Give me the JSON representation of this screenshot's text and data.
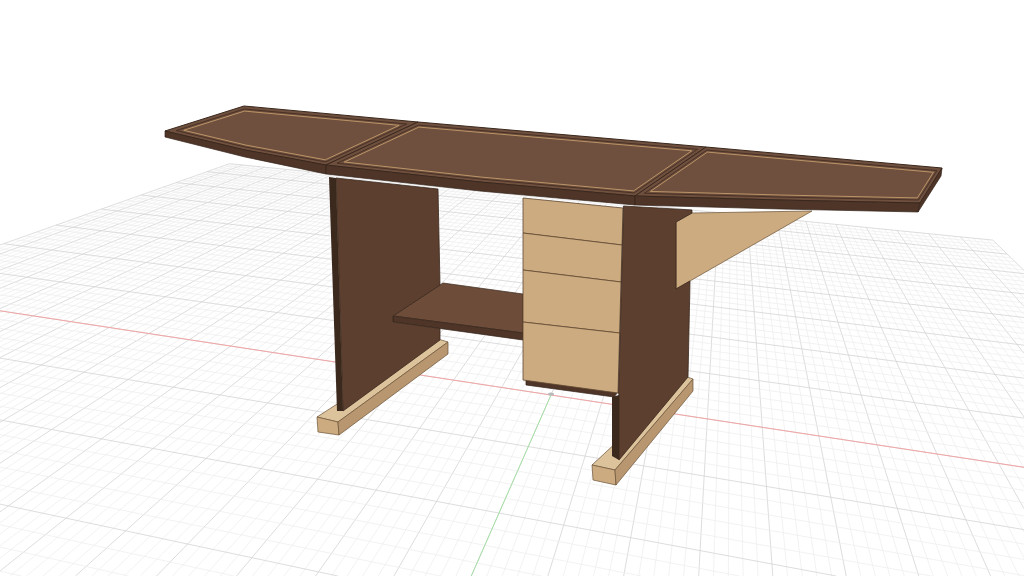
{
  "viewport": {
    "grid": true,
    "axes": [
      {
        "kind": "x",
        "color": "#f2a5a5"
      },
      {
        "kind": "y",
        "color": "#a6e0a6"
      }
    ]
  }
}
